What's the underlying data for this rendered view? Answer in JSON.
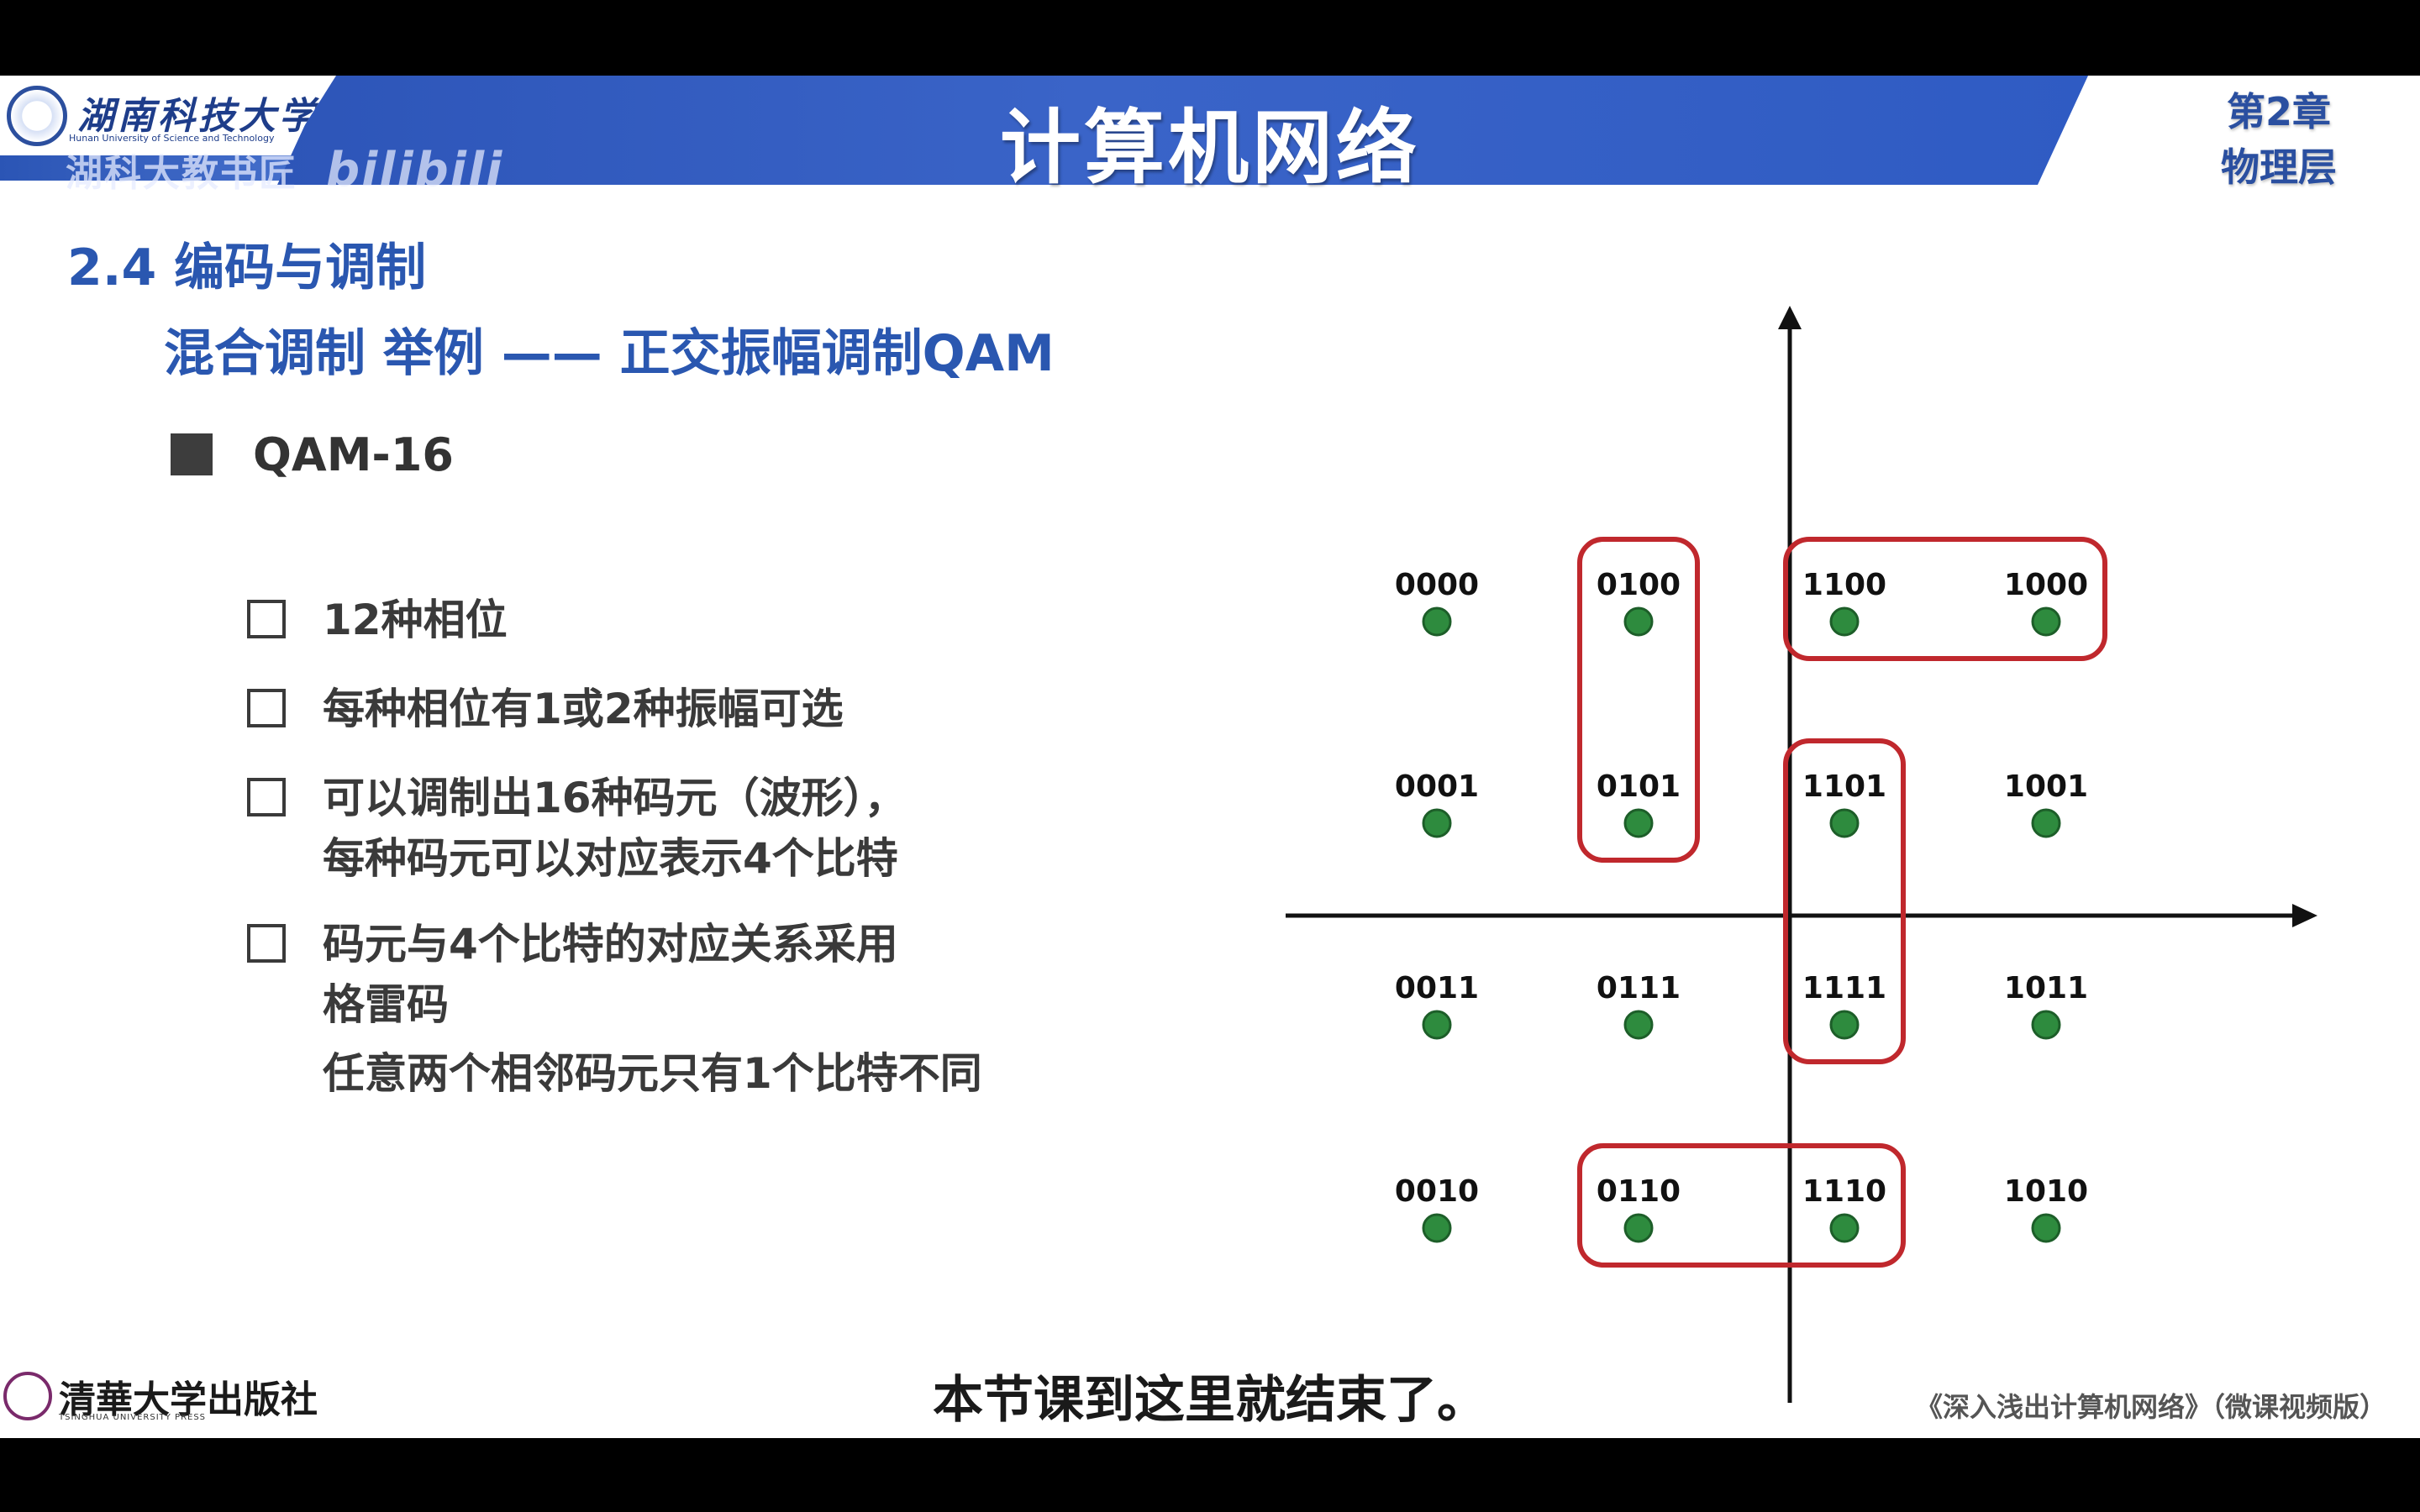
{
  "header": {
    "university_name": "湖南科技大学",
    "university_en": "Hunan University of Science and Technology",
    "title": "计算机网络",
    "chapter_line1": "第2章",
    "chapter_line2": "物理层",
    "watermark_text": "湖科大教书匠",
    "watermark_brand": "bilibili"
  },
  "content": {
    "section_title": "2.4 编码与调制",
    "subtitle": "混合调制 举例 —— 正交振幅调制QAM",
    "main_bullet": "QAM-16",
    "items": [
      {
        "lines": [
          "12种相位"
        ]
      },
      {
        "lines": [
          "每种相位有1或2种振幅可选"
        ]
      },
      {
        "lines": [
          "可以调制出16种码元（波形），",
          "每种码元可以对应表示4个比特"
        ]
      },
      {
        "lines": [
          "码元与4个比特的对应关系采用",
          "格雷码",
          "任意两个相邻码元只有1个比特不同"
        ]
      }
    ]
  },
  "constellation": {
    "point_color": "#2e8b3e",
    "highlight_color": "#c0282d",
    "points": [
      {
        "code": "0000",
        "i": -3,
        "q": 3
      },
      {
        "code": "0100",
        "i": -1,
        "q": 3
      },
      {
        "code": "1100",
        "i": 1,
        "q": 3
      },
      {
        "code": "1000",
        "i": 3,
        "q": 3
      },
      {
        "code": "0001",
        "i": -3,
        "q": 1
      },
      {
        "code": "0101",
        "i": -1,
        "q": 1
      },
      {
        "code": "1101",
        "i": 1,
        "q": 1
      },
      {
        "code": "1001",
        "i": 3,
        "q": 1
      },
      {
        "code": "0011",
        "i": -3,
        "q": -1
      },
      {
        "code": "0111",
        "i": -1,
        "q": -1
      },
      {
        "code": "1111",
        "i": 1,
        "q": -1
      },
      {
        "code": "1011",
        "i": 3,
        "q": -1
      },
      {
        "code": "0010",
        "i": -3,
        "q": -3
      },
      {
        "code": "0110",
        "i": -1,
        "q": -3
      },
      {
        "code": "1110",
        "i": 1,
        "q": -3
      },
      {
        "code": "1010",
        "i": 3,
        "q": -3
      }
    ],
    "highlights": [
      [
        "0100",
        "0101"
      ],
      [
        "1100",
        "1000"
      ],
      [
        "1101",
        "1111"
      ],
      [
        "0110",
        "1110"
      ]
    ]
  },
  "footer": {
    "caption": "本节课到这里就结束了。",
    "press_name": "清華大学出版社",
    "press_en": "TSINGHUA UNIVERSITY PRESS",
    "book_title": "《深入浅出计算机网络》（微课视频版）"
  }
}
